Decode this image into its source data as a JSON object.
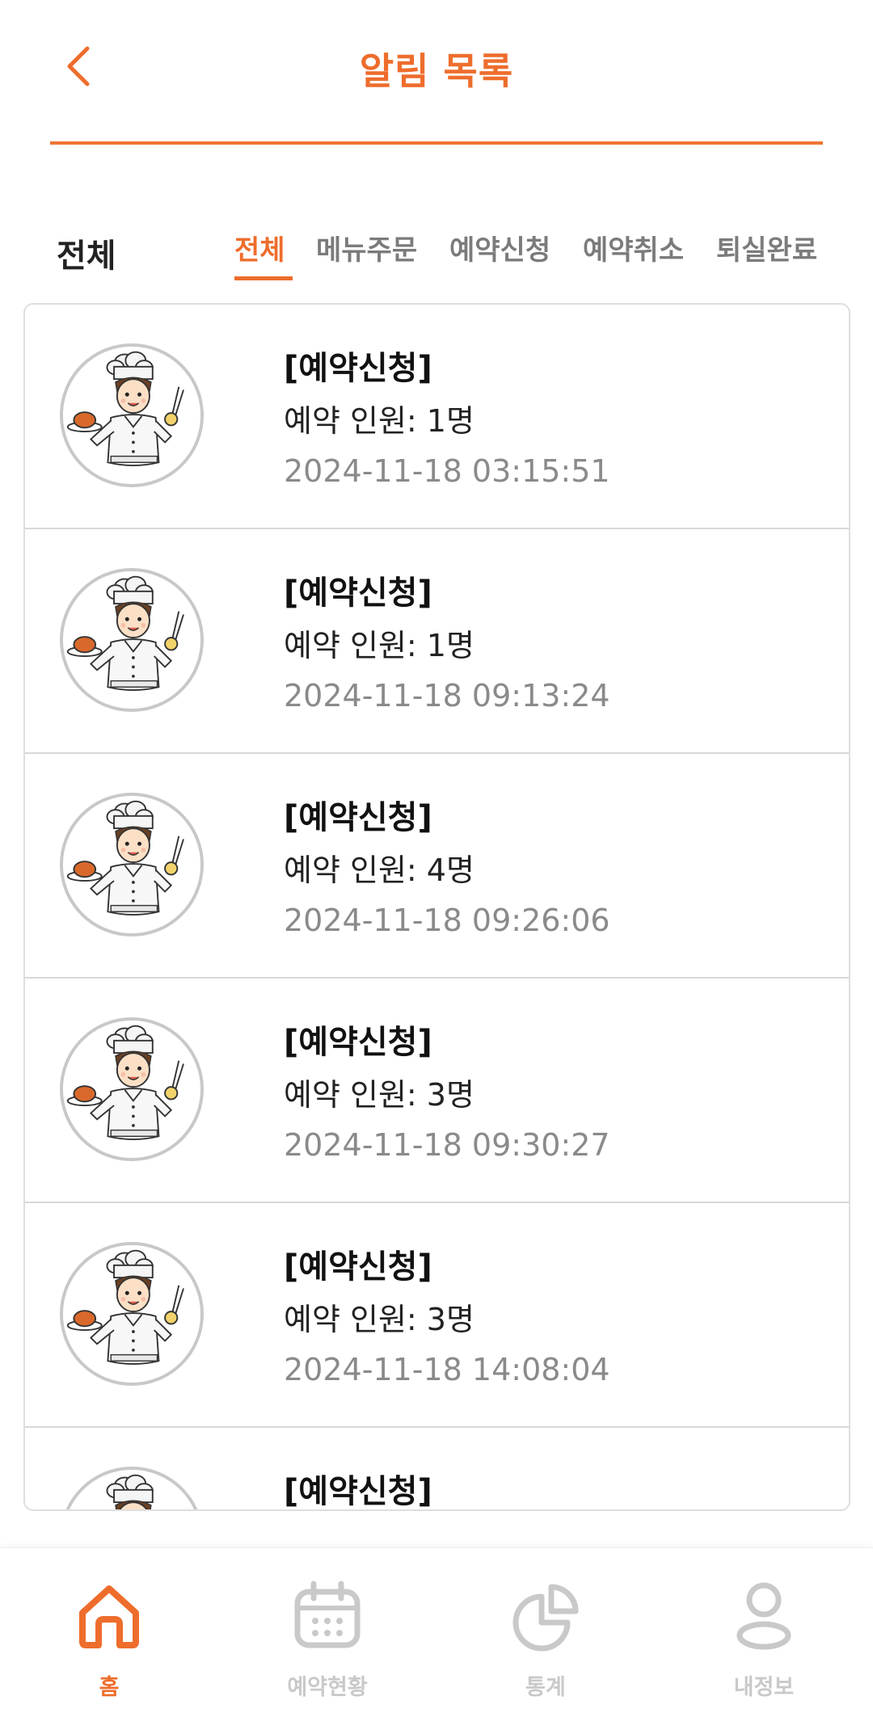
{
  "header": {
    "title": "알림 목록",
    "back_icon": "chevron-left-icon"
  },
  "filter": {
    "title": "전체",
    "tabs": [
      "전체",
      "메뉴주문",
      "예약신청",
      "예약취소",
      "퇴실완료"
    ],
    "active_tab": "전체"
  },
  "notifications": [
    {
      "title": "[예약신청]",
      "body": "예약 인원: 1명",
      "time": "2024-11-18 03:15:51"
    },
    {
      "title": "[예약신청]",
      "body": "예약 인원: 1명",
      "time": "2024-11-18 09:13:24"
    },
    {
      "title": "[예약신청]",
      "body": "예약 인원: 4명",
      "time": "2024-11-18 09:26:06"
    },
    {
      "title": "[예약신청]",
      "body": "예약 인원: 3명",
      "time": "2024-11-18 09:30:27"
    },
    {
      "title": "[예약신청]",
      "body": "예약 인원: 3명",
      "time": "2024-11-18 14:08:04"
    },
    {
      "title": "[예약신청]",
      "body": "",
      "time": ""
    }
  ],
  "bottom_nav": {
    "items": [
      {
        "label": "홈",
        "icon": "home-icon",
        "active": true
      },
      {
        "label": "예약현황",
        "icon": "calendar-icon",
        "active": false
      },
      {
        "label": "통계",
        "icon": "pie-chart-icon",
        "active": false
      },
      {
        "label": "내정보",
        "icon": "user-icon",
        "active": false
      }
    ]
  },
  "colors": {
    "accent": "#ee6d2c",
    "inactive": "#c9c9c9",
    "tab_inactive": "#7b7b7b",
    "timestamp": "#8a8a8a",
    "divider": "#d8d8d8"
  }
}
